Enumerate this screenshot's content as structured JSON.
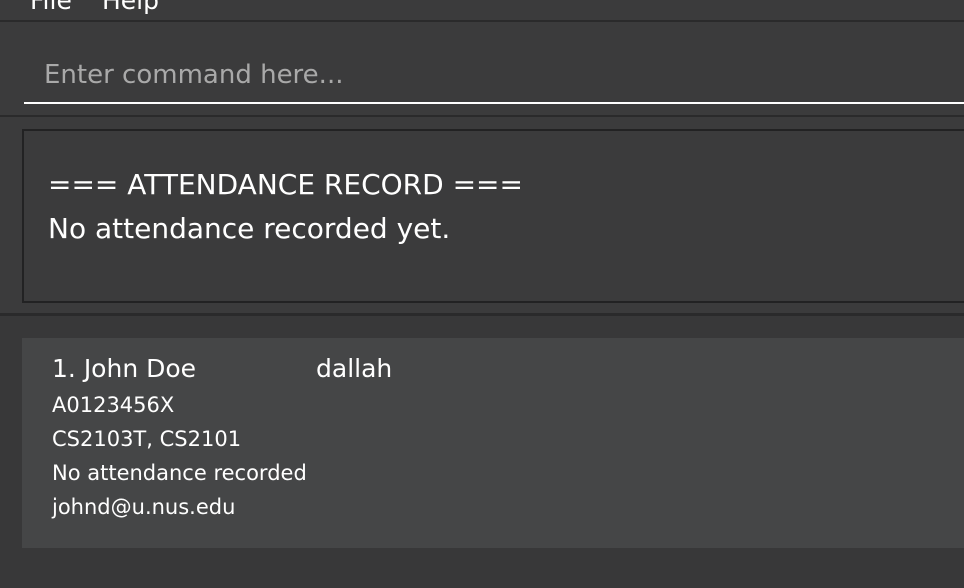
{
  "menu": {
    "file_label": "File",
    "help_label": "Help"
  },
  "command": {
    "placeholder": "Enter command here...",
    "value": ""
  },
  "result": {
    "lines": [
      "=== ATTENDANCE RECORD ===",
      "No attendance recorded yet."
    ]
  },
  "persons": [
    {
      "index": "1.",
      "name": "John Doe",
      "telegram": "dallah",
      "student_id": "A0123456X",
      "modules": "CS2103T, CS2101",
      "attendance": "No attendance recorded",
      "email": "johnd@u.nus.edu"
    }
  ]
}
